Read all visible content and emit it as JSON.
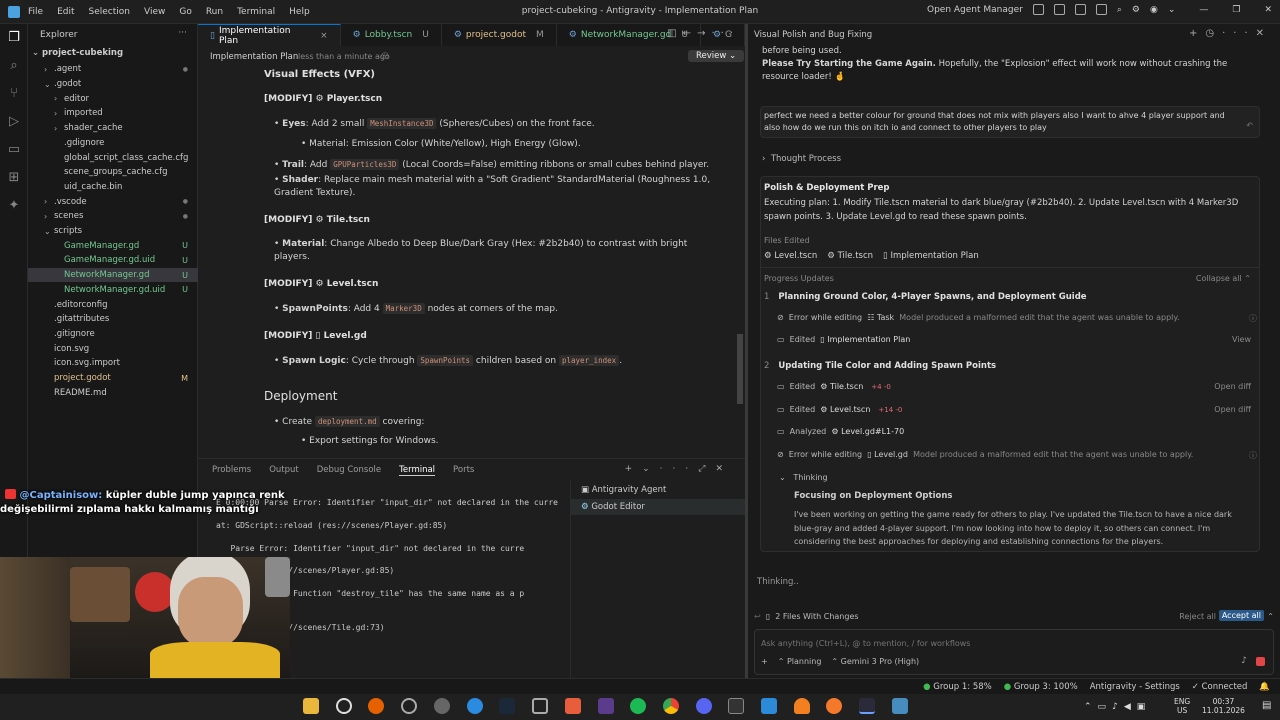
{
  "menu": [
    "File",
    "Edit",
    "Selection",
    "View",
    "Go",
    "Run",
    "Terminal",
    "Help"
  ],
  "window_title": "project-cubeking - Antigravity - Implementation Plan",
  "open_agent_manager": "Open Agent Manager",
  "explorer": {
    "title": "Explorer",
    "root": "project-cubeking",
    "items": [
      {
        "label": ".agent",
        "depth": 1,
        "chev": "›",
        "color": "#cccccc",
        "st": ""
      },
      {
        "label": ".godot",
        "depth": 1,
        "chev": "⌄",
        "color": "#cccccc",
        "st": ""
      },
      {
        "label": "editor",
        "depth": 2,
        "chev": "›",
        "color": "#cccccc",
        "st": ""
      },
      {
        "label": "imported",
        "depth": 2,
        "chev": "›",
        "color": "#cccccc",
        "st": ""
      },
      {
        "label": "shader_cache",
        "depth": 2,
        "chev": "›",
        "color": "#cccccc",
        "st": ""
      },
      {
        "label": ".gdignore",
        "depth": 2,
        "chev": "",
        "color": "#cccccc",
        "st": ""
      },
      {
        "label": "global_script_class_cache.cfg",
        "depth": 2,
        "chev": "",
        "color": "#cccccc",
        "st": ""
      },
      {
        "label": "scene_groups_cache.cfg",
        "depth": 2,
        "chev": "",
        "color": "#cccccc",
        "st": ""
      },
      {
        "label": "uid_cache.bin",
        "depth": 2,
        "chev": "",
        "color": "#cccccc",
        "st": ""
      },
      {
        "label": ".vscode",
        "depth": 1,
        "chev": "›",
        "color": "#cccccc",
        "st": ""
      },
      {
        "label": "scenes",
        "depth": 1,
        "chev": "›",
        "color": "#cccccc",
        "st": ""
      },
      {
        "label": "scripts",
        "depth": 1,
        "chev": "⌄",
        "color": "#cccccc",
        "st": ""
      },
      {
        "label": "GameManager.gd",
        "depth": 2,
        "chev": "",
        "color": "#73c991",
        "st": "U"
      },
      {
        "label": "GameManager.gd.uid",
        "depth": 2,
        "chev": "",
        "color": "#73c991",
        "st": "U"
      },
      {
        "label": "NetworkManager.gd",
        "depth": 2,
        "chev": "",
        "color": "#73c991",
        "st": "U"
      },
      {
        "label": "NetworkManager.gd.uid",
        "depth": 2,
        "chev": "",
        "color": "#73c991",
        "st": "U"
      },
      {
        "label": ".editorconfig",
        "depth": 1,
        "chev": "",
        "color": "#cccccc",
        "st": ""
      },
      {
        "label": ".gitattributes",
        "depth": 1,
        "chev": "",
        "color": "#cccccc",
        "st": ""
      },
      {
        "label": ".gitignore",
        "depth": 1,
        "chev": "",
        "color": "#cccccc",
        "st": ""
      },
      {
        "label": "icon.svg",
        "depth": 1,
        "chev": "",
        "color": "#cccccc",
        "st": ""
      },
      {
        "label": "icon.svg.import",
        "depth": 1,
        "chev": "",
        "color": "#cccccc",
        "st": ""
      },
      {
        "label": "project.godot",
        "depth": 1,
        "chev": "",
        "color": "#e2c08d",
        "st": "M"
      },
      {
        "label": "README.md",
        "depth": 1,
        "chev": "",
        "color": "#cccccc",
        "st": ""
      }
    ]
  },
  "tabs": [
    {
      "label": "Implementation Plan",
      "suffix": "×",
      "active": true
    },
    {
      "label": "Lobby.tscn",
      "suffix": "U",
      "active": false
    },
    {
      "label": "project.godot",
      "suffix": "M",
      "active": false
    },
    {
      "label": "NetworkManager.gd",
      "suffix": "U",
      "active": false
    },
    {
      "label": "G",
      "suffix": "",
      "active": false
    }
  ],
  "editor": {
    "doc_title": "Implementation Plan",
    "timestamp": "less than a minute ago",
    "review": "Review",
    "section_vfx": "Visual Effects (VFX)",
    "modify": "[MODIFY]",
    "player_file": "Player.tscn",
    "eyes_label": "Eyes",
    "eyes_a": ": Add 2 small ",
    "eyes_code": "MeshInstance3D",
    "eyes_b": " (Spheres/Cubes) on the front face.",
    "eyes_sub": "Material: Emission Color (White/Yellow), High Energy (Glow).",
    "trail_label": "Trail",
    "trail_a": ": Add ",
    "trail_code": "GPUParticles3D",
    "trail_b": " (Local Coords=False) emitting ribbons or small cubes behind player.",
    "shader_label": "Shader",
    "shader_text": ": Replace main mesh material with a \"Soft Gradient\" StandardMaterial (Roughness 1.0, Gradient Texture).",
    "tile_file": "Tile.tscn",
    "material_label": "Material",
    "material_text": ": Change Albedo to Deep Blue/Dark Gray (Hex: #2b2b40) to contrast with bright players.",
    "level_file": "Level.tscn",
    "spawn_label": "SpawnPoints",
    "spawn_a": ": Add 4 ",
    "spawn_code": "Marker3D",
    "spawn_b": " nodes at corners of the map.",
    "levelgd_file": "Level.gd",
    "logic_label": "Spawn Logic",
    "logic_a": ": Cycle through ",
    "logic_code": "SpawnPoints",
    "logic_b": " children based on ",
    "logic_code2": "player_index",
    "logic_c": ".",
    "deploy_h": "Deployment",
    "create_a": "Create ",
    "create_code": "deployment.md",
    "create_b": " covering:",
    "export_text": "Export settings for Windows."
  },
  "panel": {
    "tabs": [
      "Problems",
      "Output",
      "Debug Console",
      "Terminal",
      "Ports"
    ],
    "active": "Terminal",
    "lines": [
      "E 0:00:00 Parse Error: Identifier \"input_dir\" not declared in the curre",
      "",
      "at: GDScript::reload (res://scenes/Player.gd:85)",
      "",
      "   Parse Error: Identifier \"input_dir\" not declared in the curre",
      "",
      "   reload (res://scenes/Player.gd:85)",
      "",
      "   Parse Error: Function \"destroy_tile\" has the same name as a p",
      "   d function.",
      "",
      "   reload (res://scenes/Tile.gd:73)"
    ],
    "sessions": [
      "Antigravity Agent",
      "Godot Editor"
    ]
  },
  "overlay": {
    "user": "@Captainisow:",
    "msg": "küpler duble jump yapınca renk değişebilirmi zıplama hakkı kalmamış mantığı"
  },
  "chat": {
    "title": "Visual Polish and Bug Fixing",
    "prev_line1": "before being used.",
    "prev_bold": "Please Try Starting the Game Again.",
    "prev_line2": " Hopefully, the \"Explosion\" effect will work now without crashing the resource loader! 🤞",
    "user_msg": "perfect we need a better colour for ground that does not mix with players also I want to ahve 4 player support and also how do we run this on itch io and connect to other players to play",
    "thought": "Thought Process",
    "task_title": "Polish & Deployment Prep",
    "task_body": "Executing plan: 1. Modify Tile.tscn material to dark blue/gray (#2b2b40). 2. Update Level.tscn with 4 Marker3D spawn points. 3. Update Level.gd to read these spawn points.",
    "files_edited": "Files Edited",
    "files": [
      "Level.tscn",
      "Tile.tscn",
      "Implementation Plan"
    ],
    "progress": "Progress Updates",
    "collapse": "Collapse all",
    "step1": "Planning Ground Color, 4-Player Spawns, and Deployment Guide",
    "s1_err": "Error while editing",
    "s1_task": "Task",
    "s1_msg": "Model produced a malformed edit that the agent was unable to apply.",
    "s1_edit": "Edited",
    "s1_file": "Implementation Plan",
    "s1_view": "View",
    "step2": "Updating Tile Color and Adding Spawn Points",
    "s2_rows": [
      {
        "verb": "Edited",
        "file": "Tile.tscn",
        "diff": "+4 -0",
        "act": "Open diff"
      },
      {
        "verb": "Edited",
        "file": "Level.tscn",
        "diff": "+14 -0",
        "act": "Open diff"
      },
      {
        "verb": "Analyzed",
        "file": "Level.gd#L1-70",
        "diff": "",
        "act": ""
      }
    ],
    "s2_err": "Error while editing",
    "s2_err_file": "Level.gd",
    "s2_err_msg": "Model produced a malformed edit that the agent was unable to apply.",
    "thinking": "Thinking",
    "focus": "Focusing on Deployment Options",
    "focus_body": "I've been working on getting the game ready for others to play. I've updated the Tile.tscn to have a nice dark blue-gray and added 4-player support. I'm now looking into how to deploy it, so others can connect. I'm considering the best approaches for deploying and establishing connections for the players.",
    "status": "Thinking..",
    "changes": "2 Files With Changes",
    "reject": "Reject all",
    "accept": "Accept all",
    "input_placeholder": "Ask anything (Ctrl+L), @ to mention, / for workflows",
    "mode": "Planning",
    "model": "Gemini 3 Pro (High)"
  },
  "statusbar": {
    "group1": "Group 1: 58%",
    "group3": "Group 3: 100%",
    "settings": "Antigravity - Settings",
    "connected": "Connected"
  },
  "taskbar": {
    "lang1": "ENG",
    "lang2": "US",
    "time": "00:37",
    "date": "11.01.2026"
  },
  "colors": {
    "accent": "#0078d4",
    "untracked": "#73c991",
    "modified": "#e2c08d",
    "accept": "#2b5a8a"
  }
}
